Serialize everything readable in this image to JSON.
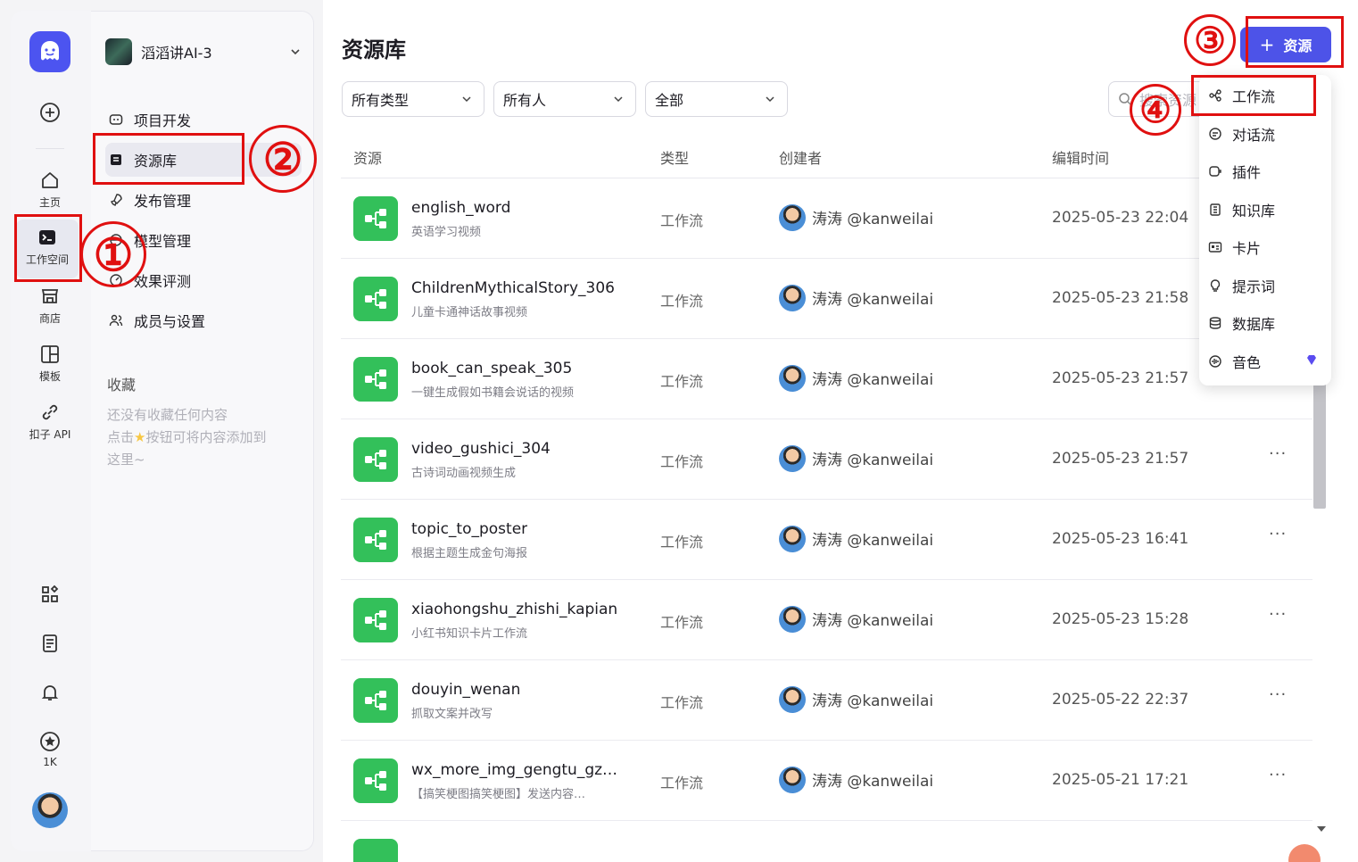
{
  "rail": {
    "items": [
      {
        "label": "主页",
        "icon": "home-icon"
      },
      {
        "label": "工作空间",
        "icon": "terminal-icon"
      },
      {
        "label": "商店",
        "icon": "store-icon"
      },
      {
        "label": "模板",
        "icon": "template-icon"
      },
      {
        "label": "扣子 API",
        "icon": "link-icon"
      }
    ],
    "star_count": "1K"
  },
  "nav": {
    "space_name": "滔滔讲AI-3",
    "items": [
      "项目开发",
      "资源库",
      "发布管理",
      "模型管理",
      "效果评测",
      "成员与设置"
    ],
    "favorites_title": "收藏",
    "favorites_desc_1": "还没有收藏任何内容",
    "favorites_desc_2": "点击",
    "favorites_desc_3": "按钮可将内容添加到",
    "favorites_desc_4": "这里~"
  },
  "main": {
    "title": "资源库",
    "add_button": "资源",
    "filters": [
      "所有类型",
      "所有人",
      "全部"
    ],
    "search_placeholder": "搜索资源",
    "columns": [
      "资源",
      "类型",
      "创建者",
      "编辑时间"
    ],
    "rows": [
      {
        "name": "english_word",
        "desc": "英语学习视频",
        "type": "工作流",
        "creator": "涛涛 @kanweilai",
        "time": "2025-05-23 22:04"
      },
      {
        "name": "ChildrenMythicalStory_306",
        "desc": "儿童卡通神话故事视频",
        "type": "工作流",
        "creator": "涛涛 @kanweilai",
        "time": "2025-05-23 21:58"
      },
      {
        "name": "book_can_speak_305",
        "desc": "一键生成假如书籍会说话的视频",
        "type": "工作流",
        "creator": "涛涛 @kanweilai",
        "time": "2025-05-23 21:57"
      },
      {
        "name": "video_gushici_304",
        "desc": "古诗词动画视频生成",
        "type": "工作流",
        "creator": "涛涛 @kanweilai",
        "time": "2025-05-23 21:57"
      },
      {
        "name": "topic_to_poster",
        "desc": "根据主题生成金句海报",
        "type": "工作流",
        "creator": "涛涛 @kanweilai",
        "time": "2025-05-23 16:41"
      },
      {
        "name": "xiaohongshu_zhishi_kapian",
        "desc": "小红书知识卡片工作流",
        "type": "工作流",
        "creator": "涛涛 @kanweilai",
        "time": "2025-05-23 15:28"
      },
      {
        "name": "douyin_wenan",
        "desc": "抓取文案并改写",
        "type": "工作流",
        "creator": "涛涛 @kanweilai",
        "time": "2025-05-22 22:37"
      },
      {
        "name": "wx_more_img_gengtu_gz…",
        "desc": "【搞笑梗图搞笑梗图】发送内容…",
        "type": "工作流",
        "creator": "涛涛 @kanweilai",
        "time": "2025-05-21 17:21"
      }
    ],
    "more": "···"
  },
  "menu": {
    "items": [
      "工作流",
      "对话流",
      "插件",
      "知识库",
      "卡片",
      "提示词",
      "数据库",
      "音色"
    ]
  },
  "annotations": [
    "①",
    "②",
    "③",
    "④"
  ],
  "colors": {
    "accent": "#4d53e8",
    "workflow_green": "#33c05a",
    "annotation_red": "#e01010"
  }
}
